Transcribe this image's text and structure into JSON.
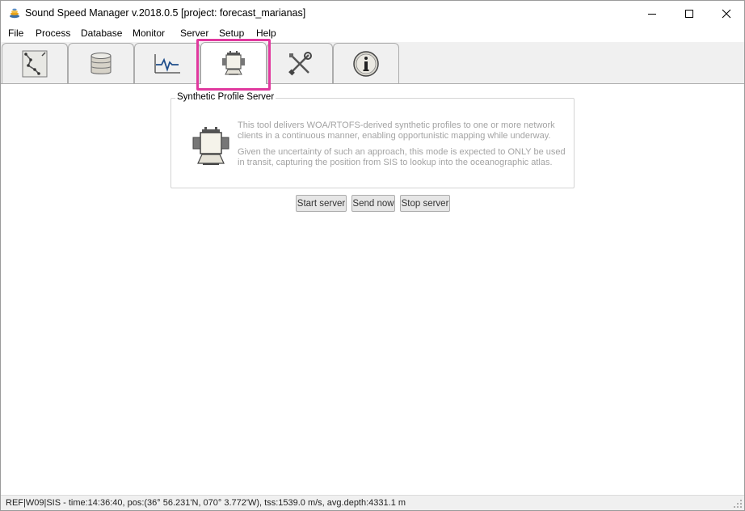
{
  "window": {
    "title": "Sound Speed Manager v.2018.0.5 [project: forecast_marianas]"
  },
  "menu": {
    "items": [
      {
        "label": "File"
      },
      {
        "label": "Process"
      },
      {
        "label": "Database"
      },
      {
        "label": "Monitor"
      },
      {
        "label": "Server"
      },
      {
        "label": "Setup"
      },
      {
        "label": "Help"
      }
    ]
  },
  "tabs": [
    {
      "icon": "profile-editor-icon",
      "active": false
    },
    {
      "icon": "database-icon",
      "active": false
    },
    {
      "icon": "monitor-icon",
      "active": false
    },
    {
      "icon": "server-icon",
      "active": true
    },
    {
      "icon": "tools-icon",
      "active": false
    },
    {
      "icon": "info-icon",
      "active": false
    }
  ],
  "colors": {
    "highlight": "#e0399e",
    "description_text": "#a3a3a3"
  },
  "server_panel": {
    "group_title": "Synthetic Profile Server",
    "description_1": "This tool delivers WOA/RTOFS-derived synthetic profiles to one or more network clients in a continuous manner, enabling opportunistic mapping while underway.",
    "description_2": "Given the uncertainty of such an approach, this mode is expected to ONLY be used in transit, capturing the position from SIS to lookup into the oceanographic atlas.",
    "buttons": {
      "start": "Start server",
      "send": "Send now",
      "stop": "Stop server"
    }
  },
  "status_bar": {
    "text": "REF|W09|SIS  -  time:14:36:40, pos:(36° 56.231'N, 070°  3.772'W),  tss:1539.0 m/s,  avg.depth:4331.1 m"
  }
}
